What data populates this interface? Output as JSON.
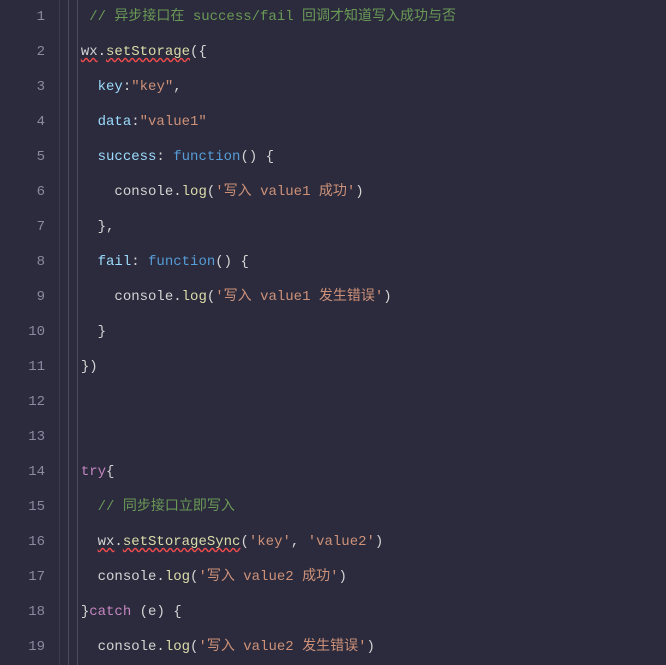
{
  "lines": [
    {
      "num": "1",
      "tokens": [
        {
          "cls": "tok-comment",
          "indent": "   ",
          "text": "// 异步接口在 success/fail 回调才知道写入成功与否"
        }
      ]
    },
    {
      "num": "2",
      "tokens": [
        {
          "cls": "tok-obj squiggle",
          "indent": "  ",
          "text": "wx"
        },
        {
          "cls": "tok-default",
          "text": "."
        },
        {
          "cls": "tok-method squiggle",
          "text": "setStorage"
        },
        {
          "cls": "tok-default",
          "text": "({"
        }
      ]
    },
    {
      "num": "3",
      "tokens": [
        {
          "cls": "tok-prop",
          "indent": "    ",
          "text": "key"
        },
        {
          "cls": "tok-default",
          "text": ":"
        },
        {
          "cls": "tok-string",
          "text": "\"key\""
        },
        {
          "cls": "tok-default",
          "text": ","
        }
      ]
    },
    {
      "num": "4",
      "tokens": [
        {
          "cls": "tok-prop",
          "indent": "    ",
          "text": "data"
        },
        {
          "cls": "tok-default",
          "text": ":"
        },
        {
          "cls": "tok-string",
          "text": "\"value1\""
        }
      ]
    },
    {
      "num": "5",
      "tokens": [
        {
          "cls": "tok-prop",
          "indent": "    ",
          "text": "success"
        },
        {
          "cls": "tok-default",
          "text": ": "
        },
        {
          "cls": "tok-func",
          "text": "function"
        },
        {
          "cls": "tok-default",
          "text": "() {"
        }
      ]
    },
    {
      "num": "6",
      "tokens": [
        {
          "cls": "tok-obj",
          "indent": "      ",
          "text": "console"
        },
        {
          "cls": "tok-default",
          "text": "."
        },
        {
          "cls": "tok-method",
          "text": "log"
        },
        {
          "cls": "tok-default",
          "text": "("
        },
        {
          "cls": "tok-string",
          "text": "'写入 value1 成功'"
        },
        {
          "cls": "tok-default",
          "text": ")"
        }
      ]
    },
    {
      "num": "7",
      "tokens": [
        {
          "cls": "tok-default",
          "indent": "    ",
          "text": "},"
        }
      ]
    },
    {
      "num": "8",
      "tokens": [
        {
          "cls": "tok-prop",
          "indent": "    ",
          "text": "fail"
        },
        {
          "cls": "tok-default",
          "text": ": "
        },
        {
          "cls": "tok-func",
          "text": "function"
        },
        {
          "cls": "tok-default",
          "text": "() {"
        }
      ]
    },
    {
      "num": "9",
      "tokens": [
        {
          "cls": "tok-obj",
          "indent": "      ",
          "text": "console"
        },
        {
          "cls": "tok-default",
          "text": "."
        },
        {
          "cls": "tok-method",
          "text": "log"
        },
        {
          "cls": "tok-default",
          "text": "("
        },
        {
          "cls": "tok-string",
          "text": "'写入 value1 发生错误'"
        },
        {
          "cls": "tok-default",
          "text": ")"
        }
      ]
    },
    {
      "num": "10",
      "tokens": [
        {
          "cls": "tok-default",
          "indent": "    ",
          "text": "}"
        }
      ]
    },
    {
      "num": "11",
      "tokens": [
        {
          "cls": "tok-default",
          "indent": "  ",
          "text": "})"
        }
      ]
    },
    {
      "num": "12",
      "tokens": []
    },
    {
      "num": "13",
      "tokens": []
    },
    {
      "num": "14",
      "tokens": [
        {
          "cls": "tok-keyword",
          "indent": "  ",
          "text": "try"
        },
        {
          "cls": "tok-default",
          "text": "{"
        }
      ]
    },
    {
      "num": "15",
      "tokens": [
        {
          "cls": "tok-comment",
          "indent": "    ",
          "text": "// 同步接口立即写入"
        }
      ]
    },
    {
      "num": "16",
      "tokens": [
        {
          "cls": "tok-obj squiggle",
          "indent": "    ",
          "text": "wx"
        },
        {
          "cls": "tok-default",
          "text": "."
        },
        {
          "cls": "tok-method squiggle",
          "text": "setStorageSync"
        },
        {
          "cls": "tok-default",
          "text": "("
        },
        {
          "cls": "tok-string",
          "text": "'key'"
        },
        {
          "cls": "tok-default",
          "text": ", "
        },
        {
          "cls": "tok-string",
          "text": "'value2'"
        },
        {
          "cls": "tok-default",
          "text": ")"
        }
      ]
    },
    {
      "num": "17",
      "tokens": [
        {
          "cls": "tok-obj",
          "indent": "    ",
          "text": "console"
        },
        {
          "cls": "tok-default",
          "text": "."
        },
        {
          "cls": "tok-method",
          "text": "log"
        },
        {
          "cls": "tok-default",
          "text": "("
        },
        {
          "cls": "tok-string",
          "text": "'写入 value2 成功'"
        },
        {
          "cls": "tok-default",
          "text": ")"
        }
      ]
    },
    {
      "num": "18",
      "tokens": [
        {
          "cls": "tok-default",
          "indent": "  ",
          "text": "}"
        },
        {
          "cls": "tok-keyword",
          "text": "catch"
        },
        {
          "cls": "tok-default",
          "text": " (e) {"
        }
      ]
    },
    {
      "num": "19",
      "tokens": [
        {
          "cls": "tok-obj",
          "indent": "    ",
          "text": "console"
        },
        {
          "cls": "tok-default",
          "text": "."
        },
        {
          "cls": "tok-method",
          "text": "log"
        },
        {
          "cls": "tok-default",
          "text": "("
        },
        {
          "cls": "tok-string",
          "text": "'写入 value2 发生错误'"
        },
        {
          "cls": "tok-default",
          "text": ")"
        }
      ]
    }
  ]
}
